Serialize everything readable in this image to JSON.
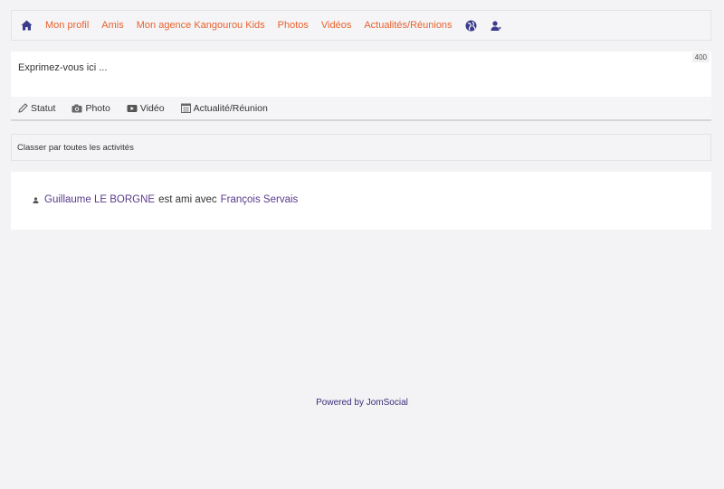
{
  "nav": {
    "items": [
      {
        "label": "Mon profil"
      },
      {
        "label": "Amis"
      },
      {
        "label": "Mon agence Kangourou Kids"
      },
      {
        "label": "Photos"
      },
      {
        "label": "Vidéos"
      },
      {
        "label": "Actualités/Réunions"
      }
    ],
    "icons": [
      "home-icon",
      "globe-icon",
      "user-icon"
    ]
  },
  "composer": {
    "placeholder": "Exprimez-vous ici ...",
    "char_limit": "400"
  },
  "composer_tabs": [
    {
      "label": "Statut",
      "icon": "pencil-icon"
    },
    {
      "label": "Photo",
      "icon": "camera-icon"
    },
    {
      "label": "Vidéo",
      "icon": "video-icon"
    },
    {
      "label": "Actualité/Réunion",
      "icon": "calendar-icon"
    }
  ],
  "filter": {
    "label": "Classer par toutes les activités"
  },
  "activity": {
    "actor": "Guillaume LE BORGNE",
    "verb": "est ami avec",
    "target": "François Servais"
  },
  "footer": {
    "text": "Powered by JomSocial"
  },
  "colors": {
    "nav_link": "#e8612c",
    "icon": "#3b3a8c",
    "user_link": "#5a3a8c",
    "background": "#f3f3f5"
  }
}
